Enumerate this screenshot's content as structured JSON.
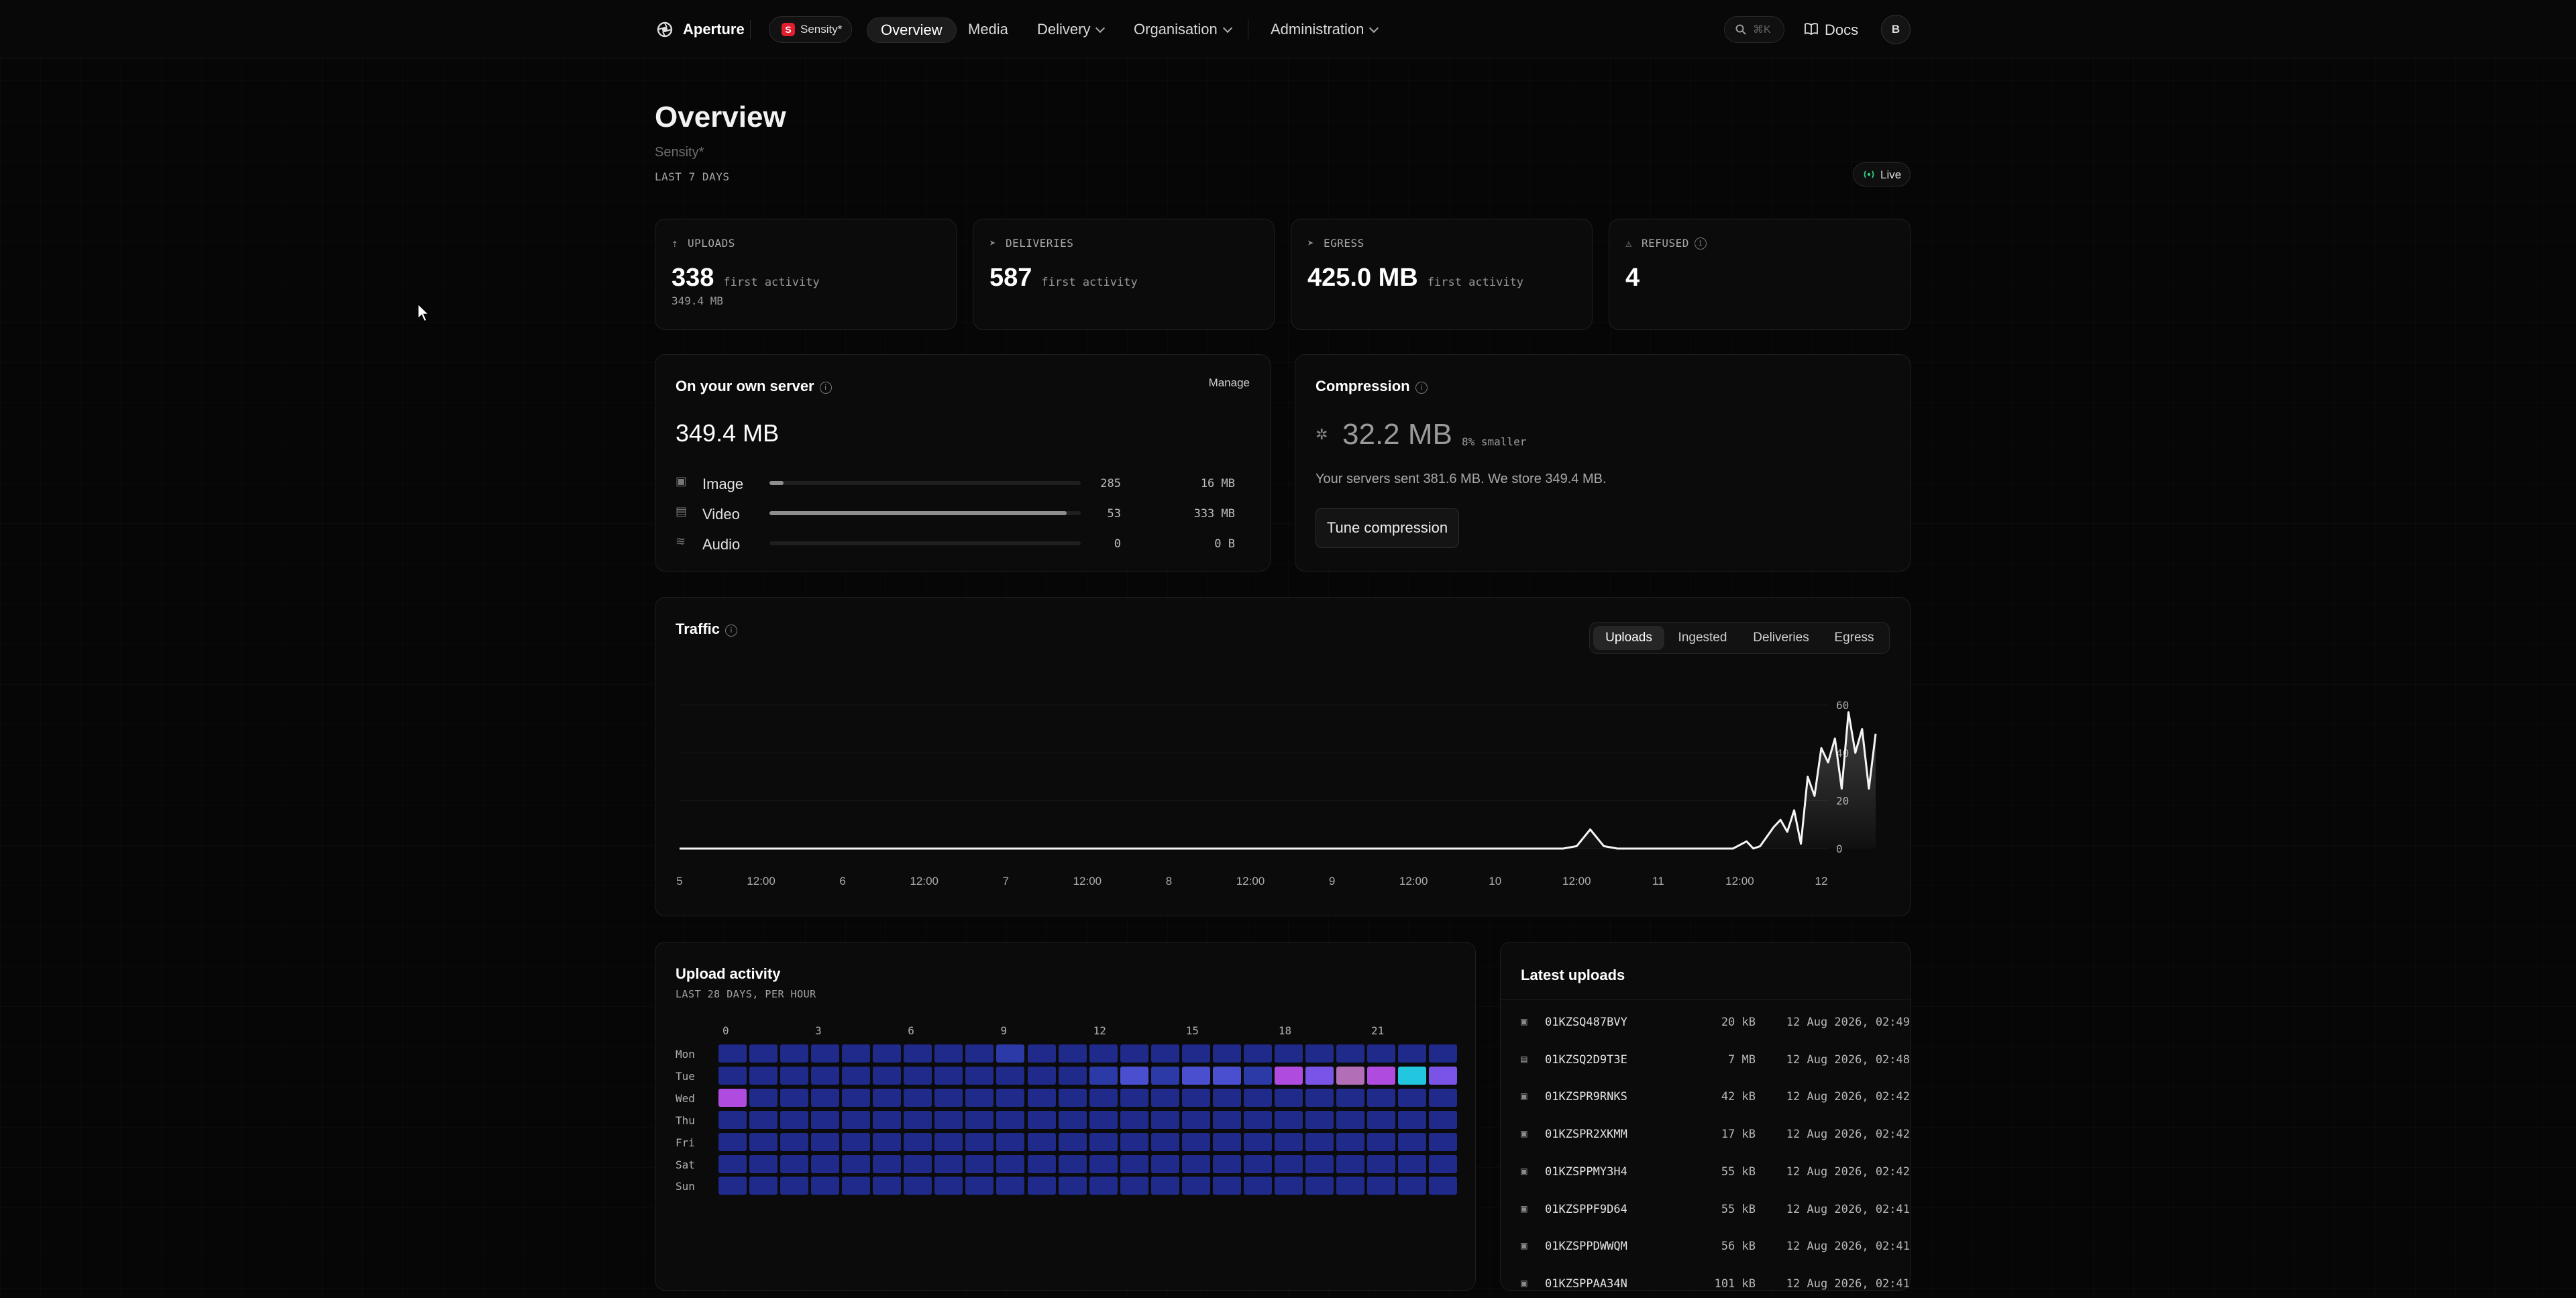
{
  "topbar": {
    "brand": "Aperture",
    "workspace_badge_letter": "S",
    "workspace_name": "Sensity*",
    "nav": [
      {
        "label": "Overview",
        "active": true
      },
      {
        "label": "Media",
        "active": false
      },
      {
        "label": "Delivery",
        "dropdown": true
      },
      {
        "label": "Organisation",
        "dropdown": true
      },
      {
        "label": "Administration",
        "dropdown": true
      }
    ],
    "search_shortcut": "⌘K",
    "docs_label": "Docs",
    "avatar_initial": "B"
  },
  "header": {
    "title": "Overview",
    "subtitle": "Sensity*",
    "range_label": "LAST 7 DAYS",
    "live_label": "Live"
  },
  "stats": [
    {
      "label": "UPLOADS",
      "value": "338",
      "sub": "first activity",
      "sub2": "349.4 MB",
      "icon": "upload-icon"
    },
    {
      "label": "DELIVERIES",
      "value": "587",
      "sub": "first activity",
      "sub2": "",
      "icon": "send-icon"
    },
    {
      "label": "EGRESS",
      "value": "425.0 MB",
      "sub": "first activity",
      "sub2": "",
      "icon": "send-icon"
    },
    {
      "label": "REFUSED",
      "value": "4",
      "sub": "",
      "sub2": "",
      "icon": "warning-icon"
    }
  ],
  "own_server": {
    "title": "On your own server",
    "manage_label": "Manage",
    "total": "349.4 MB",
    "rows": [
      {
        "label": "Image",
        "count": "285",
        "size": "16 MB",
        "fraction": 0.045
      },
      {
        "label": "Video",
        "count": "53",
        "size": "333 MB",
        "fraction": 0.955
      },
      {
        "label": "Audio",
        "count": "0",
        "size": "0 B",
        "fraction": 0
      }
    ]
  },
  "compression": {
    "title": "Compression",
    "value": "32.2 MB",
    "badge": "8% smaller",
    "description": "Your servers sent 381.6 MB. We store 349.4 MB.",
    "button_label": "Tune compression"
  },
  "traffic": {
    "title": "Traffic",
    "tabs": [
      "Uploads",
      "Ingested",
      "Deliveries",
      "Egress"
    ],
    "active_tab": "Uploads"
  },
  "chart_data": {
    "type": "area",
    "title": "Traffic",
    "xlabel": "",
    "ylabel": "",
    "x_tick_labels": [
      "5",
      "12:00",
      "6",
      "12:00",
      "7",
      "12:00",
      "8",
      "12:00",
      "9",
      "12:00",
      "10",
      "12:00",
      "11",
      "12:00",
      "12"
    ],
    "y_tick_labels": [
      "60",
      "40",
      "20",
      "0"
    ],
    "ylim": [
      0,
      60
    ],
    "xlim": [
      0,
      168
    ],
    "grid": true,
    "series": [
      {
        "values": [
          [
            0,
            0
          ],
          [
            130,
            0
          ],
          [
            132,
            1
          ],
          [
            134,
            8
          ],
          [
            136,
            1
          ],
          [
            138,
            0
          ],
          [
            155,
            0
          ],
          [
            157,
            3
          ],
          [
            158,
            0
          ],
          [
            159,
            1
          ],
          [
            161,
            9
          ],
          [
            162,
            12
          ],
          [
            163,
            7
          ],
          [
            164,
            16
          ],
          [
            165,
            2
          ],
          [
            166,
            30
          ],
          [
            167,
            22
          ],
          [
            168,
            42
          ],
          [
            169,
            36
          ],
          [
            170,
            46
          ],
          [
            171,
            25
          ],
          [
            172,
            57
          ],
          [
            173,
            40
          ],
          [
            174,
            50
          ],
          [
            175,
            25
          ],
          [
            176,
            48
          ]
        ]
      }
    ]
  },
  "upload_activity": {
    "title": "Upload activity",
    "subtitle": "LAST 28 DAYS, PER HOUR",
    "days": [
      "Mon",
      "Tue",
      "Wed",
      "Thu",
      "Fri",
      "Sat",
      "Sun"
    ],
    "hour_labels": [
      "0",
      "3",
      "6",
      "9",
      "12",
      "15",
      "18",
      "21"
    ],
    "levels": [
      [
        0,
        0,
        0,
        0,
        0,
        0,
        0,
        0,
        0,
        1,
        0,
        0,
        0,
        0,
        0,
        0,
        0,
        0,
        0,
        0,
        0,
        0,
        0,
        0
      ],
      [
        0,
        0,
        0,
        0,
        0,
        0,
        0,
        0,
        0,
        0,
        0,
        0,
        1,
        2,
        1,
        2,
        2,
        1,
        4,
        3,
        5,
        4,
        6,
        3
      ],
      [
        4,
        0,
        0,
        0,
        0,
        0,
        0,
        0,
        0,
        0,
        0,
        0,
        0,
        0,
        0,
        0,
        0,
        0,
        0,
        0,
        0,
        0,
        0,
        0
      ],
      [
        0,
        0,
        0,
        0,
        0,
        0,
        0,
        0,
        0,
        0,
        0,
        0,
        0,
        0,
        0,
        0,
        0,
        0,
        0,
        0,
        0,
        0,
        0,
        0
      ],
      [
        0,
        0,
        0,
        0,
        0,
        0,
        0,
        0,
        0,
        0,
        0,
        0,
        0,
        0,
        0,
        0,
        0,
        0,
        0,
        0,
        0,
        0,
        0,
        0
      ],
      [
        0,
        0,
        0,
        0,
        0,
        0,
        0,
        0,
        0,
        0,
        0,
        0,
        0,
        0,
        0,
        0,
        0,
        0,
        0,
        0,
        0,
        0,
        0,
        0
      ],
      [
        0,
        0,
        0,
        0,
        0,
        0,
        0,
        0,
        0,
        0,
        0,
        0,
        0,
        0,
        0,
        0,
        0,
        0,
        0,
        0,
        0,
        0,
        0,
        0
      ]
    ],
    "level_colors": [
      "#1f2a8a",
      "#2c3aa8",
      "#4a4fd0",
      "#7a54e6",
      "#b04be0",
      "#b26fb8",
      "#22c7df"
    ]
  },
  "latest_uploads": {
    "title": "Latest uploads",
    "rows": [
      {
        "id": "01KZSQ487BVY",
        "size": "20 kB",
        "date": "12 Aug 2026, 02:49",
        "icon": "image-icon"
      },
      {
        "id": "01KZSQ2D9T3E",
        "size": "7 MB",
        "date": "12 Aug 2026, 02:48",
        "icon": "film-icon"
      },
      {
        "id": "01KZSPR9RNKS",
        "size": "42 kB",
        "date": "12 Aug 2026, 02:42",
        "icon": "image-icon"
      },
      {
        "id": "01KZSPR2XKMM",
        "size": "17 kB",
        "date": "12 Aug 2026, 02:42",
        "icon": "image-icon"
      },
      {
        "id": "01KZSPPMY3H4",
        "size": "55 kB",
        "date": "12 Aug 2026, 02:42",
        "icon": "image-icon"
      },
      {
        "id": "01KZSPPF9D64",
        "size": "55 kB",
        "date": "12 Aug 2026, 02:41",
        "icon": "image-icon"
      },
      {
        "id": "01KZSPPDWWQM",
        "size": "56 kB",
        "date": "12 Aug 2026, 02:41",
        "icon": "image-icon"
      },
      {
        "id": "01KZSPPAA34N",
        "size": "101 kB",
        "date": "12 Aug 2026, 02:41",
        "icon": "image-icon"
      }
    ]
  }
}
